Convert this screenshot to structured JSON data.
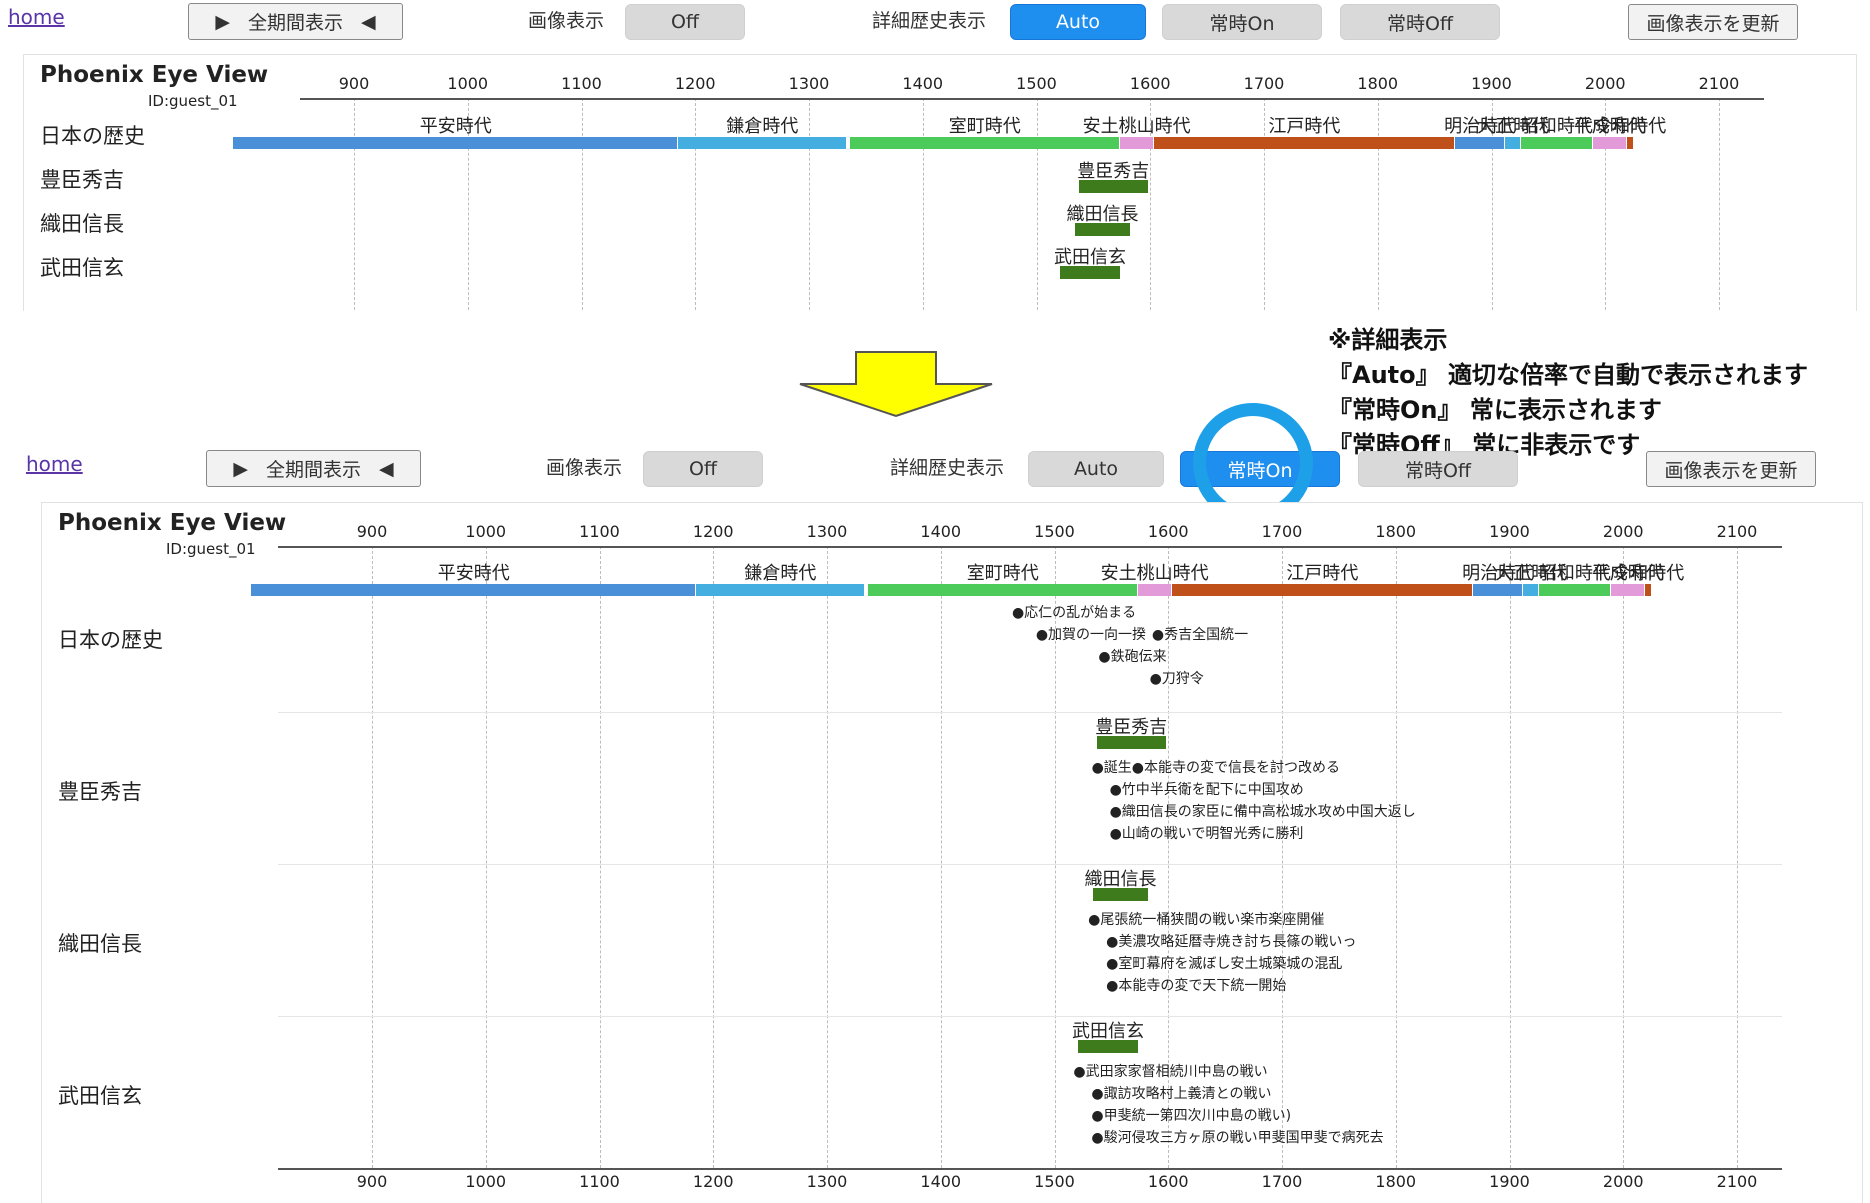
{
  "top": {
    "home": "home",
    "full_period": "全期間表示",
    "image_label": "画像表示",
    "image_value": "Off",
    "detail_label": "詳細歴史表示",
    "auto": "Auto",
    "always_on": "常時On",
    "always_off": "常時Off",
    "refresh": "画像表示を更新",
    "title": "Phoenix Eye View",
    "user_id": "ID:guest_01",
    "rows": [
      "日本の歴史",
      "豊臣秀吉",
      "織田信長",
      "武田信玄"
    ]
  },
  "bottom": {
    "home": "home",
    "full_period": "全期間表示",
    "image_label": "画像表示",
    "image_value": "Off",
    "detail_label": "詳細歴史表示",
    "auto": "Auto",
    "always_on": "常時On",
    "always_off": "常時Off",
    "refresh": "画像表示を更新",
    "title": "Phoenix Eye View",
    "user_id": "ID:guest_01",
    "rows": [
      "日本の歴史",
      "豊臣秀吉",
      "織田信長",
      "武田信玄"
    ]
  },
  "ticks": [
    "900",
    "1000",
    "1100",
    "1200",
    "1300",
    "1400",
    "1500",
    "1600",
    "1700",
    "1800",
    "1900",
    "2000",
    "2100"
  ],
  "eras": [
    {
      "name": "平安時代",
      "start": 794,
      "end": 1185,
      "color": "#4a90d9"
    },
    {
      "name": "鎌倉時代",
      "start": 1185,
      "end": 1333,
      "color": "#44aee0"
    },
    {
      "name": "室町時代",
      "start": 1336,
      "end": 1573,
      "color": "#4ccb5a"
    },
    {
      "name": "安土桃山時代",
      "start": 1573,
      "end": 1603,
      "color": "#e39ad9"
    },
    {
      "name": "江戸時代",
      "start": 1603,
      "end": 1868,
      "color": "#c0501a"
    },
    {
      "name": "明治時代",
      "start": 1868,
      "end": 1912,
      "color": "#4a90d9"
    },
    {
      "name": "大正時代",
      "start": 1912,
      "end": 1926,
      "color": "#44aee0"
    },
    {
      "name": "昭和時代",
      "start": 1926,
      "end": 1989,
      "color": "#4ccb5a"
    },
    {
      "name": "平成時代",
      "start": 1989,
      "end": 2019,
      "color": "#e39ad9"
    },
    {
      "name": "令和時代",
      "start": 2019,
      "end": 2025,
      "color": "#c0501a"
    }
  ],
  "persons": [
    {
      "name": "豊臣秀吉",
      "start": 1537,
      "end": 1598
    },
    {
      "name": "織田信長",
      "start": 1534,
      "end": 1582
    },
    {
      "name": "武田信玄",
      "start": 1521,
      "end": 1573
    }
  ],
  "history_events": [
    {
      "year": 1467,
      "label": "応仁の乱が始まる"
    },
    {
      "year": 1590,
      "label": "秀吉全国統一"
    },
    {
      "year": 1488,
      "label": "加賀の一向一揆"
    },
    {
      "year": 1543,
      "label": "鉄砲伝来"
    },
    {
      "year": 1588,
      "label": "刀狩令"
    }
  ],
  "overlapped_events": {
    "hideyoshi": [
      "●誕生●本能寺の変で信長を討つ改める",
      "●竹中半兵衛を配下に中国攻め",
      "●織田信長の家臣に備中高松城水攻め中国大返し",
      "●山崎の戦いで明智光秀に勝利"
    ],
    "nobunaga": [
      "●尾張統一桶狭間の戦い楽市楽座開催",
      "●美濃攻略延暦寺焼き討ち長篠の戦いっ",
      "●室町幕府を滅ぼし安土城築城の混乱",
      "●本能寺の変で天下統一開始"
    ],
    "shingen": [
      "●武田家家督相続川中島の戦い",
      "●諏訪攻略村上義清との戦い",
      "●甲斐統一第四次川中島の戦い)",
      "●駿河侵攻三方ヶ原の戦い甲斐国甲斐で病死去"
    ]
  },
  "note": {
    "title": "※詳細表示",
    "line1": "『Auto』 適切な倍率で自動で表示されます",
    "line2": "『常時On』 常に表示されます",
    "line3": "『常時Off』 常に非表示です"
  },
  "colors": {
    "accent": "#1e8eef",
    "highlight_ring": "#1ea0e8",
    "arrow": "#ffff00",
    "person_bar": "#3d7b1c"
  }
}
